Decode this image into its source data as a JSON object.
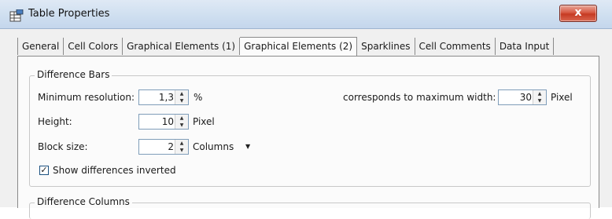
{
  "window": {
    "title": "Table Properties",
    "close_label": "x"
  },
  "tabs": [
    {
      "label": "General",
      "active": false
    },
    {
      "label": "Cell Colors",
      "active": false
    },
    {
      "label": "Graphical Elements (1)",
      "active": false
    },
    {
      "label": "Graphical Elements (2)",
      "active": true
    },
    {
      "label": "Sparklines",
      "active": false
    },
    {
      "label": "Cell Comments",
      "active": false
    },
    {
      "label": "Data Input",
      "active": false
    }
  ],
  "difference_bars": {
    "legend": "Difference Bars",
    "min_resolution_label": "Minimum resolution:",
    "min_resolution_value": "1,3",
    "min_resolution_unit": "%",
    "max_width_label": "corresponds to maximum width:",
    "max_width_value": "30",
    "max_width_unit": "Pixel",
    "height_label": "Height:",
    "height_value": "10",
    "height_unit": "Pixel",
    "block_size_label": "Block size:",
    "block_size_value": "2",
    "block_size_unit": "Columns",
    "show_inverted_label": "Show differences inverted",
    "show_inverted_checked": true
  },
  "difference_columns": {
    "legend": "Difference Columns"
  }
}
